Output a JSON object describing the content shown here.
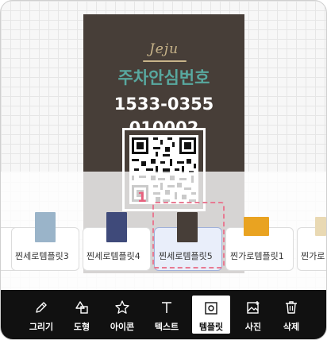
{
  "card": {
    "logo": "Jeju",
    "title": "주차안심번호",
    "phone": "1533-0355",
    "code": "010002",
    "bg_color": "#473e38",
    "title_color": "#58a89f"
  },
  "templates": {
    "step_number": "1",
    "items": [
      {
        "label": "찐세로템플릿3",
        "thumb": "#9ab4c9",
        "selected": false
      },
      {
        "label": "찐세로템플릿4",
        "thumb": "#3f4a7a",
        "selected": false
      },
      {
        "label": "찐세로템플릿5",
        "thumb": "#473e38",
        "selected": true
      },
      {
        "label": "찐가로템플릿1",
        "thumb": "#e9a321",
        "selected": false
      },
      {
        "label": "찐가로",
        "thumb": "#e9d9b3",
        "selected": false
      }
    ]
  },
  "toolbar": {
    "items": [
      {
        "label": "그리기",
        "icon": "pencil-icon"
      },
      {
        "label": "도형",
        "icon": "shapes-icon"
      },
      {
        "label": "아이콘",
        "icon": "star-icon"
      },
      {
        "label": "텍스트",
        "icon": "text-icon"
      },
      {
        "label": "템플릿",
        "icon": "template-icon",
        "active": true
      },
      {
        "label": "사진",
        "icon": "photo-icon"
      },
      {
        "label": "삭제",
        "icon": "trash-icon"
      }
    ]
  }
}
